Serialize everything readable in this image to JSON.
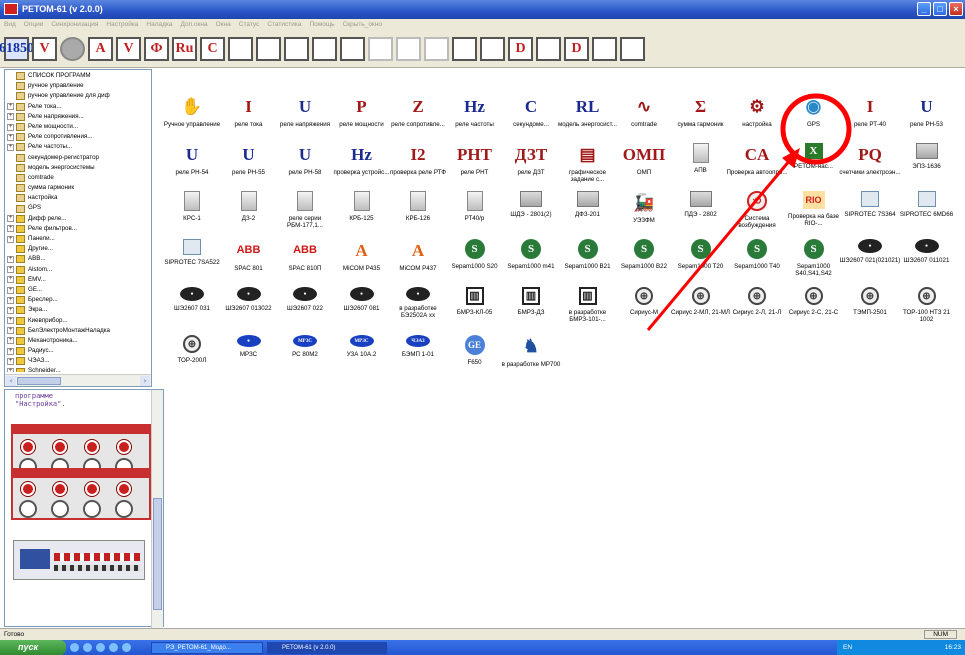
{
  "window": {
    "title": "РЕТОМ-61 (v 2.0.0)"
  },
  "menu": [
    "Вид",
    "Опции",
    "Синхронизация",
    "Настройка",
    "Наладка",
    "Доп.окна",
    "Окна",
    "Статус",
    "Статистика",
    "Помощь",
    "Скрыть_окно"
  ],
  "toolbar": [
    "61850",
    "V",
    "",
    "A",
    "V",
    "Ф",
    "Ru",
    "C",
    "",
    "",
    "",
    "",
    "",
    "",
    "",
    "",
    "",
    "",
    "D",
    "",
    "D",
    "",
    ""
  ],
  "tree": [
    {
      "label": "СПИСОК ПРОГРАММ",
      "exp": "",
      "ico": "f"
    },
    {
      "label": "ручное управление",
      "exp": " ",
      "ico": "f"
    },
    {
      "label": "ручное управление для диф",
      "exp": " ",
      "ico": "f"
    },
    {
      "label": "Реле тока...",
      "exp": "+",
      "ico": "f"
    },
    {
      "label": "Реле напряжения...",
      "exp": "+",
      "ico": "f"
    },
    {
      "label": "Реле мощности...",
      "exp": "+",
      "ico": "f"
    },
    {
      "label": "Реле сопротивления...",
      "exp": "+",
      "ico": "f"
    },
    {
      "label": "Реле частоты...",
      "exp": "+",
      "ico": "f"
    },
    {
      "label": "секундомер-регистратор",
      "exp": " ",
      "ico": "f"
    },
    {
      "label": "модель энергосистемы",
      "exp": " ",
      "ico": "f"
    },
    {
      "label": "comtrade",
      "exp": " ",
      "ico": "f"
    },
    {
      "label": "сумма гармоник",
      "exp": " ",
      "ico": "f"
    },
    {
      "label": "настройка",
      "exp": " ",
      "ico": "f"
    },
    {
      "label": "GPS",
      "exp": " ",
      "ico": "f"
    },
    {
      "label": "Дифф реле...",
      "exp": "+",
      "ico": ""
    },
    {
      "label": "Реле фильтров...",
      "exp": "+",
      "ico": ""
    },
    {
      "label": "Панели...",
      "exp": "+",
      "ico": ""
    },
    {
      "label": "Другие...",
      "exp": " ",
      "ico": ""
    },
    {
      "label": "ABB...",
      "exp": "+",
      "ico": ""
    },
    {
      "label": "Alstom...",
      "exp": "+",
      "ico": ""
    },
    {
      "label": "EMV...",
      "exp": "+",
      "ico": ""
    },
    {
      "label": "GE...",
      "exp": "+",
      "ico": ""
    },
    {
      "label": "Бреслер...",
      "exp": "+",
      "ico": ""
    },
    {
      "label": "Экра...",
      "exp": "+",
      "ico": ""
    },
    {
      "label": "Киевприбор...",
      "exp": "+",
      "ico": ""
    },
    {
      "label": "БелЭлектроМонтажНаладка",
      "exp": "+",
      "ico": ""
    },
    {
      "label": "Механотроника...",
      "exp": "+",
      "ico": ""
    },
    {
      "label": "Радиус...",
      "exp": "+",
      "ico": ""
    },
    {
      "label": "ЧЭАЗ...",
      "exp": "+",
      "ico": ""
    },
    {
      "label": "Schneider...",
      "exp": "+",
      "ico": ""
    }
  ],
  "panel2": {
    "line1": "программе",
    "line2": "\"Настройка\"."
  },
  "items": [
    [
      "Ручное управление",
      "реле тока",
      "реле напряжения",
      "реле мощности",
      "реле сопротивле...",
      "реле частоты",
      "секундоме...",
      "модель энергосист...",
      "comtrade",
      "сумма гармоник",
      "настройка",
      "GPS",
      "реле РТ-40",
      "реле РН-53"
    ],
    [
      "реле РН-54",
      "реле РН-55",
      "реле РН-58",
      "проверка устройс...",
      "проверка реле РТФ",
      "реле РНТ",
      "реле ДЗТ",
      "графическое задание с...",
      "ОМП",
      "АПВ",
      "Проверка автоопро...",
      "РЕТОМ-нас...",
      "счетчики электроэн...",
      "ЭПЗ-1636"
    ],
    [
      "КРС-1",
      "ДЗ-2",
      "реле серии РБМ-177,1...",
      "КРБ-125",
      "КРБ-126",
      "РТ40/р",
      "ШДЭ - 2801(2)",
      "ДФЗ-201",
      "УЭЗФМ",
      "ПДЭ - 2802",
      "Система возбуждения",
      "Проверка на базе RIO-...",
      "SIPROTEC 7S364",
      "SIPROTEC 6MD66"
    ],
    [
      "SIPROTEC 7SA522",
      "SPAC 801",
      "SPAC 810П",
      "MiCOM P435",
      "MiCOM P437",
      "Sepam1000 S20",
      "Sepam1000 m41",
      "Sepam1000 B21",
      "Sepam1000 B22",
      "Sepam1000 T20",
      "Sepam1000 T40",
      "Sepam1000 S40,S41,S42",
      "ШЭ2607 021(021021)",
      "ШЭ2607 011021"
    ],
    [
      "ШЭ2607 031",
      "ШЭ2607 013022",
      "ШЭ2607 022",
      "ШЭ2607 081",
      "в разработке БЭ2502А хх",
      "БМРЗ-КЛ-05",
      "БМРЗ-ДЗ",
      "в разработке БМРЗ-101-...",
      "Сириус-М",
      "Сириус 2-МЛ, 21-МЛ",
      "Сириус 2-Л, 21-Л",
      "Сириус 2-С, 21-С",
      "ТЭМП-2501",
      "ТОР-100 НТЗ 21 1002"
    ],
    [
      "ТОР-200Л",
      "МРЗС",
      "РС 80М2",
      "УЗА 10А.2",
      "БЭМП 1-01",
      "F650",
      "в разработке МР700"
    ]
  ],
  "icons": [
    [
      "hand",
      "I",
      "U",
      "P",
      "Z",
      "Hz",
      "C",
      "RL",
      "wave",
      "Σ",
      "gear",
      "globe",
      "I",
      "U"
    ],
    [
      "U",
      "U",
      "U",
      "Hz",
      "I2",
      "РНТ",
      "ДЗТ",
      "graph",
      "ОМП",
      "gray",
      "CA",
      "X",
      "PQ",
      "gray2"
    ],
    [
      "gray",
      "gray",
      "gray",
      "gray",
      "gray",
      "gray",
      "gray2",
      "gray2",
      "train",
      "gray2",
      "sync",
      "RIO",
      "siem",
      "siem"
    ],
    [
      "siem",
      "ABB",
      "ABB",
      "A",
      "A",
      "S",
      "S",
      "S",
      "S",
      "S",
      "S",
      "S",
      "dark",
      "dark"
    ],
    [
      "dark",
      "dark",
      "dark",
      "dark",
      "dark",
      "bar",
      "bar",
      "bar",
      "circ",
      "circ",
      "circ",
      "circ",
      "circ",
      "circ"
    ],
    [
      "circ",
      "blueoval",
      "МРЗС",
      "МРЗС",
      "ЧЭАЗ",
      "GE",
      "chess"
    ]
  ],
  "status": {
    "left": "Готово",
    "right": "NUM"
  },
  "taskbar": {
    "start": "пуск",
    "tasks": [
      "РЭ_РЕТОМ-61_Модо...",
      "РЕТОМ-61 (v 2.0.0)"
    ],
    "lang": "EN",
    "clock": "16:23"
  },
  "colors": {
    "title": "#2a55c8",
    "highlight": "#ff0000"
  }
}
